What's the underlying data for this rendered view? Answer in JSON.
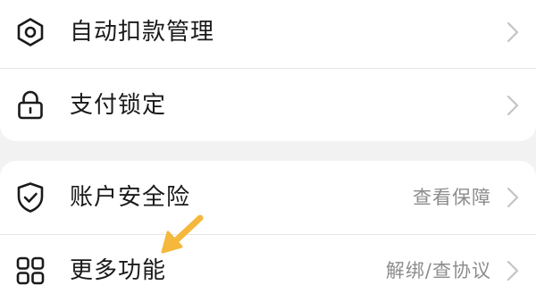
{
  "colors": {
    "background": "#f2f2f2",
    "card": "#ffffff",
    "text_primary": "#1a1a1a",
    "text_secondary": "#8c8c8c",
    "chevron": "#c4c4c4",
    "divider": "#e8e8e8",
    "annotation_arrow": "#f5b83d"
  },
  "settings": {
    "group1": [
      {
        "label": "自动扣款管理",
        "value": "",
        "icon": "gear-icon"
      },
      {
        "label": "支付锁定",
        "value": "",
        "icon": "lock-icon"
      }
    ],
    "group2": [
      {
        "label": "账户安全险",
        "value": "查看保障",
        "icon": "shield-check-icon"
      },
      {
        "label": "更多功能",
        "value": "解绑/查协议",
        "icon": "grid-icon"
      }
    ]
  },
  "annotation": {
    "icon": "pointer-arrow-icon",
    "target": "更多功能"
  }
}
